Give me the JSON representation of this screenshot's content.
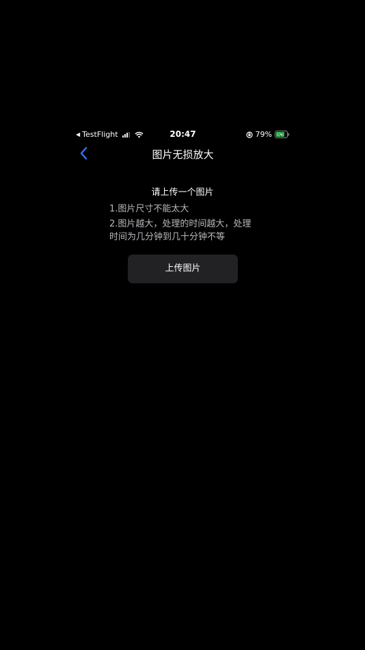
{
  "status_bar": {
    "back_app": "TestFlight",
    "time": "20:47",
    "battery_percent": "79%",
    "battery_level": 0.79,
    "signal_bars_active": 3
  },
  "nav": {
    "title": "图片无损放大",
    "accent_color": "#3478F6"
  },
  "content": {
    "prompt": "请上传一个图片",
    "notes": [
      "1.图片尺寸不能太大",
      "2.图片越大，处理的时间越大，处理时间为几分钟到几十分钟不等"
    ],
    "upload_label": "上传图片"
  },
  "colors": {
    "background": "#000000",
    "button_bg": "#222224",
    "note_text": "#B9B9BD"
  }
}
